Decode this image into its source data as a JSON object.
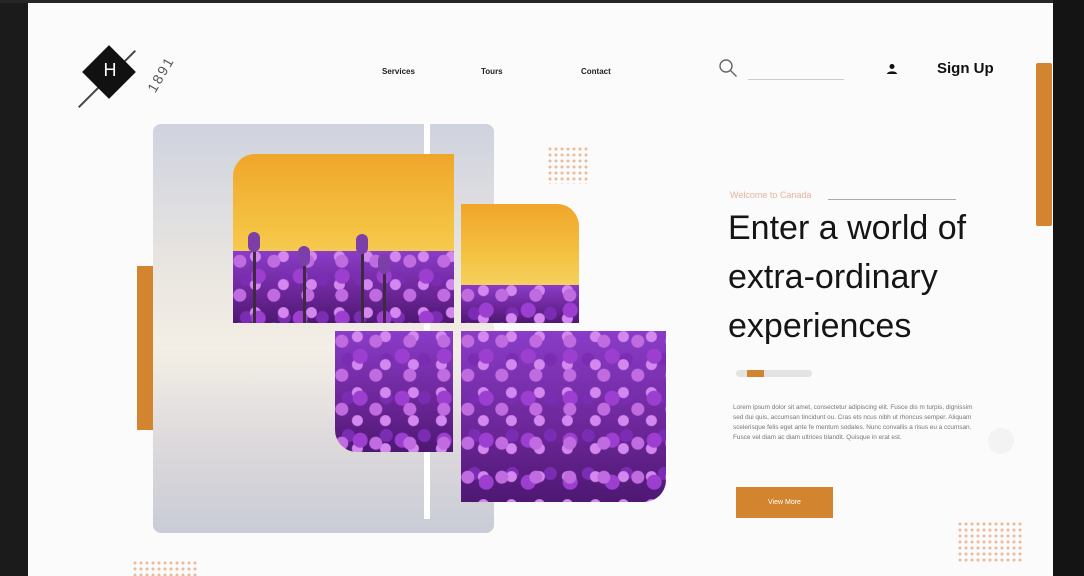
{
  "brand": {
    "letter": "H",
    "year": "1891"
  },
  "nav": {
    "services": "Services",
    "tours": "Tours",
    "contact": "Contact"
  },
  "header": {
    "signup_label": "Sign Up"
  },
  "hero": {
    "welcome": "Welcome to Canada",
    "headline": "Enter a world of extra-ordinary experiences",
    "body": "Lorem ipsum dolor sit amet, consectetur adipiscing elit. Fusce dis m turpis, dignissim sed dui quis, accumsan tincidunt ou. Cras ets ncus nibh ut rhoncus semper. Aliquam scelerisque felis eget ante fe mentum sodales. Nunc convallis a risus eu a ccumsan. Fusce vel diam ac diam ultrices blandit. Quisque in erat est.",
    "cta_label": "View More",
    "slider": {
      "current": 2,
      "total": 4
    }
  },
  "colors": {
    "accent": "#d2842f",
    "text": "#151515",
    "background": "#fbfbfb"
  },
  "icons": {
    "search": "search-icon",
    "user": "user-icon"
  }
}
